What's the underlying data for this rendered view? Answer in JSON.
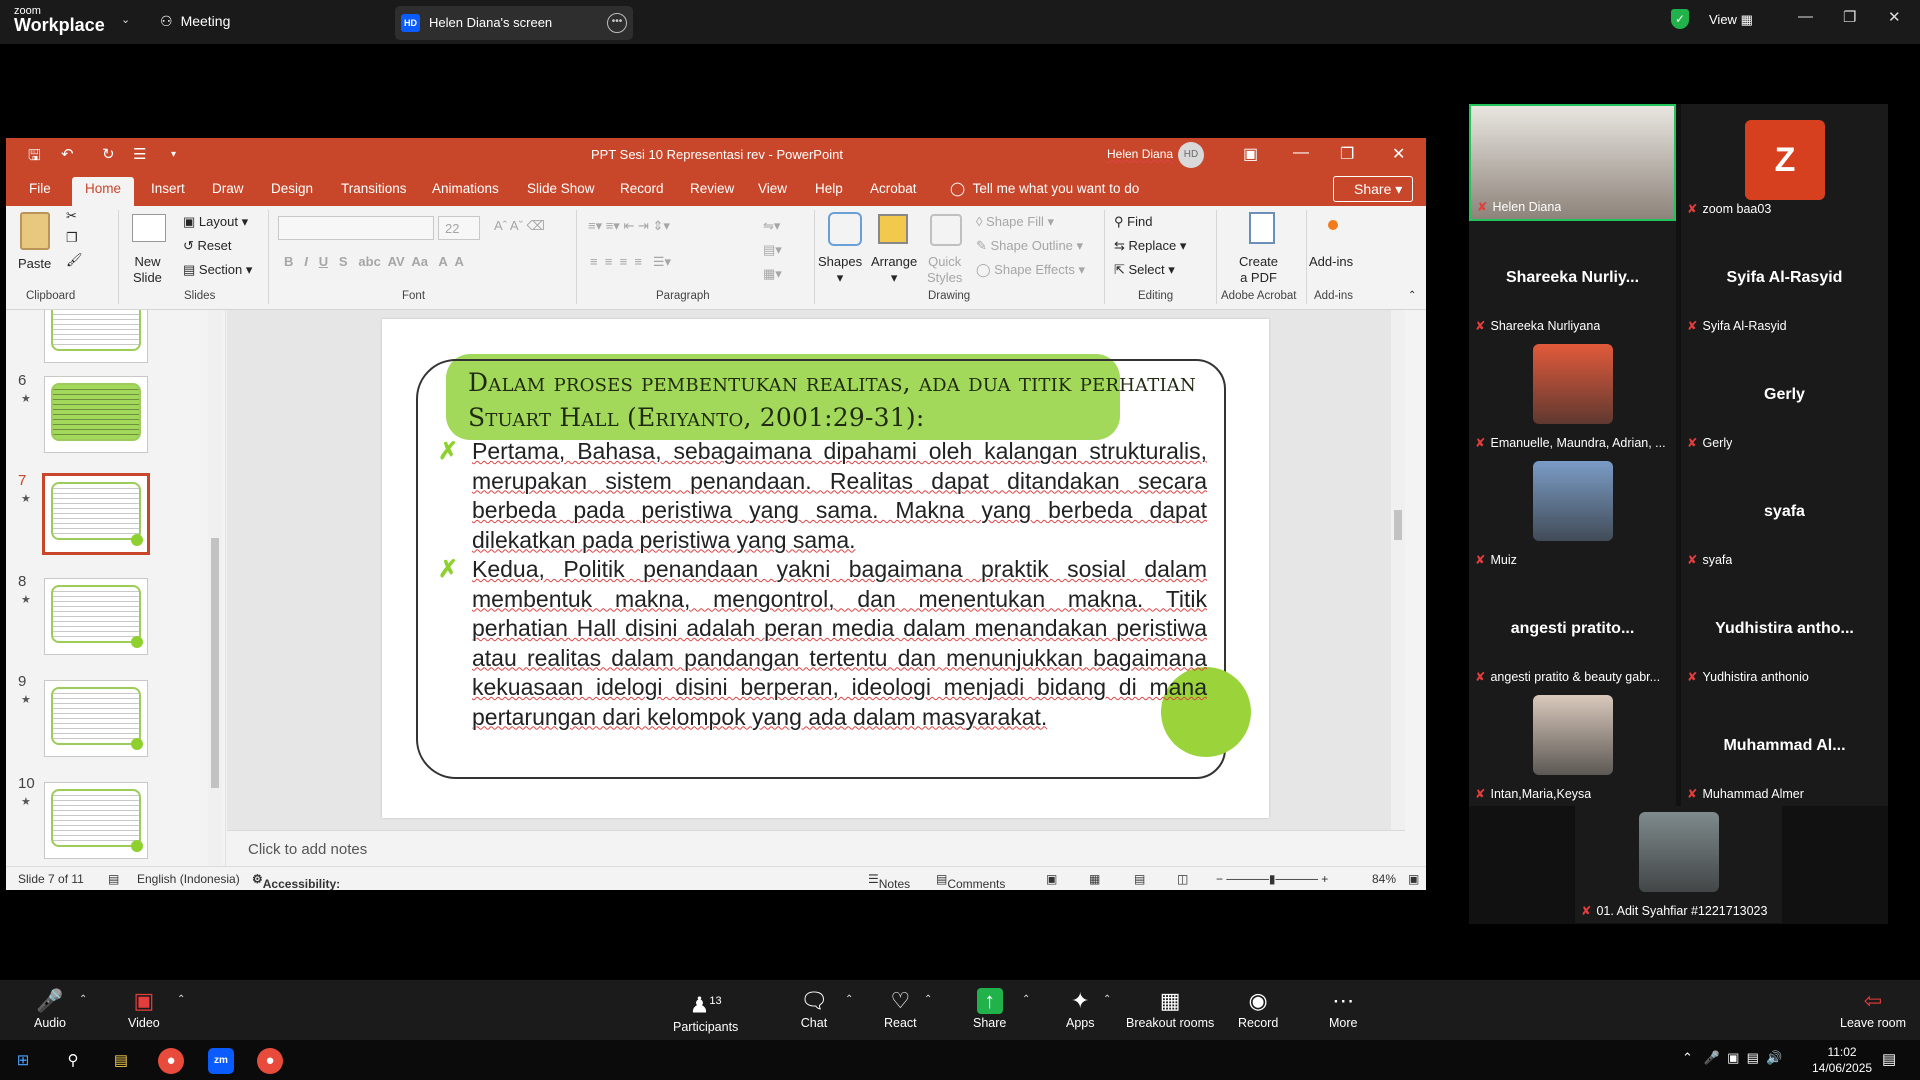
{
  "zoom": {
    "brand_top": "zoom",
    "brand_bottom": "Workplace",
    "meeting_label": "Meeting",
    "share_initials": "HD",
    "share_title": "Helen Diana's screen",
    "view_label": "View",
    "accent": "#0b5cff"
  },
  "ppt": {
    "title": "PPT Sesi 10 Representasi rev  -  PowerPoint",
    "user": "Helen Diana",
    "user_initials": "HD",
    "tabs": [
      "File",
      "Home",
      "Insert",
      "Draw",
      "Design",
      "Transitions",
      "Animations",
      "Slide Show",
      "Record",
      "Review",
      "View",
      "Help",
      "Acrobat"
    ],
    "tell_me": "Tell me what you want to do",
    "share": "Share",
    "ribbon": {
      "paste": "Paste",
      "clipboard": "Clipboard",
      "new_slide": [
        "New",
        "Slide"
      ],
      "layout": "Layout",
      "reset": "Reset",
      "section": "Section",
      "slides": "Slides",
      "font_size": "22",
      "font": "Font",
      "paragraph": "Paragraph",
      "shapes": "Shapes",
      "arrange": "Arrange",
      "quick_styles": [
        "Quick",
        "Styles"
      ],
      "shape_fill": "Shape Fill",
      "shape_outline": "Shape Outline",
      "shape_effects": "Shape Effects",
      "drawing": "Drawing",
      "find": "Find",
      "replace": "Replace",
      "select": "Select",
      "editing": "Editing",
      "create_pdf": [
        "Create",
        "a PDF"
      ],
      "adobe_acrobat": "Adobe Acrobat",
      "addins": "Add-ins",
      "addins_group": "Add-ins"
    },
    "thumbnail_numbers": [
      "6",
      "7",
      "8",
      "9",
      "10"
    ],
    "slide": {
      "title_line1": "Dalam proses pembentukan realitas, ada dua titik perhatian",
      "title_line2": "Stuart Hall (Eriyanto, 2001:29-31):",
      "bullet1": "Pertama, Bahasa, sebagaimana dipahami oleh kalangan strukturalis, merupakan sistem penandaan. Realitas dapat ditandakan secara berbeda pada peristiwa yang sama. Makna yang berbeda dapat dilekatkan pada peristiwa yang sama.",
      "bullet2": "Kedua, Politik penandaan yakni bagaimana praktik sosial dalam membentuk makna, mengontrol, dan menentukan makna. Titik perhatian Hall disini adalah peran media dalam menandakan peristiwa atau realitas dalam pandangan tertentu dan menunjukkan bagaimana kekuasaan idelogi disini berperan, ideologi menjadi bidang di mana pertarungan dari kelompok yang ada dalam masyarakat.",
      "highlight_color": "#a2d95a"
    },
    "notes_placeholder": "Click to add notes",
    "status": {
      "slide": "Slide 7 of 11",
      "language": "English (Indonesia)",
      "accessibility": "Accessibility: Investigate",
      "notes": "Notes",
      "comments": "Comments",
      "zoom": "84%"
    }
  },
  "participants": [
    {
      "name": "Helen Diana",
      "big": "",
      "photo": true
    },
    {
      "name": "zoom baa03",
      "big": "Z",
      "photo": false
    },
    {
      "name": "Shareeka Nurliyana",
      "big": "Shareeka  Nurliy...",
      "photo": false
    },
    {
      "name": "Syifa Al-Rasyid",
      "big": "Syifa Al-Rasyid",
      "photo": false
    },
    {
      "name": "Emanuelle, Maundra, Adrian, ...",
      "big": "",
      "photo": true
    },
    {
      "name": "Gerly",
      "big": "Gerly",
      "photo": false
    },
    {
      "name": "Muiz",
      "big": "",
      "photo": true
    },
    {
      "name": "syafa",
      "big": "syafa",
      "photo": false
    },
    {
      "name": "angesti pratito & beauty gabr...",
      "big": "angesti  pratito...",
      "photo": false
    },
    {
      "name": "Yudhistira anthonio",
      "big": "Yudhistira  antho...",
      "photo": false
    },
    {
      "name": "Intan,Maria,Keysa",
      "big": "",
      "photo": true
    },
    {
      "name": "Muhammad Almer",
      "big": "Muhammad  Al...",
      "photo": false
    },
    {
      "name": "01. Adit Syahfiar #1221713023",
      "big": "",
      "photo": true
    }
  ],
  "controls": {
    "audio": "Audio",
    "video": "Video",
    "participants": "Participants",
    "participants_count": "13",
    "chat": "Chat",
    "react": "React",
    "share": "Share",
    "apps": "Apps",
    "breakout": "Breakout rooms",
    "record": "Record",
    "more": "More",
    "leave": "Leave room"
  },
  "taskbar": {
    "time": "11:02",
    "date": "14/06/2025"
  }
}
